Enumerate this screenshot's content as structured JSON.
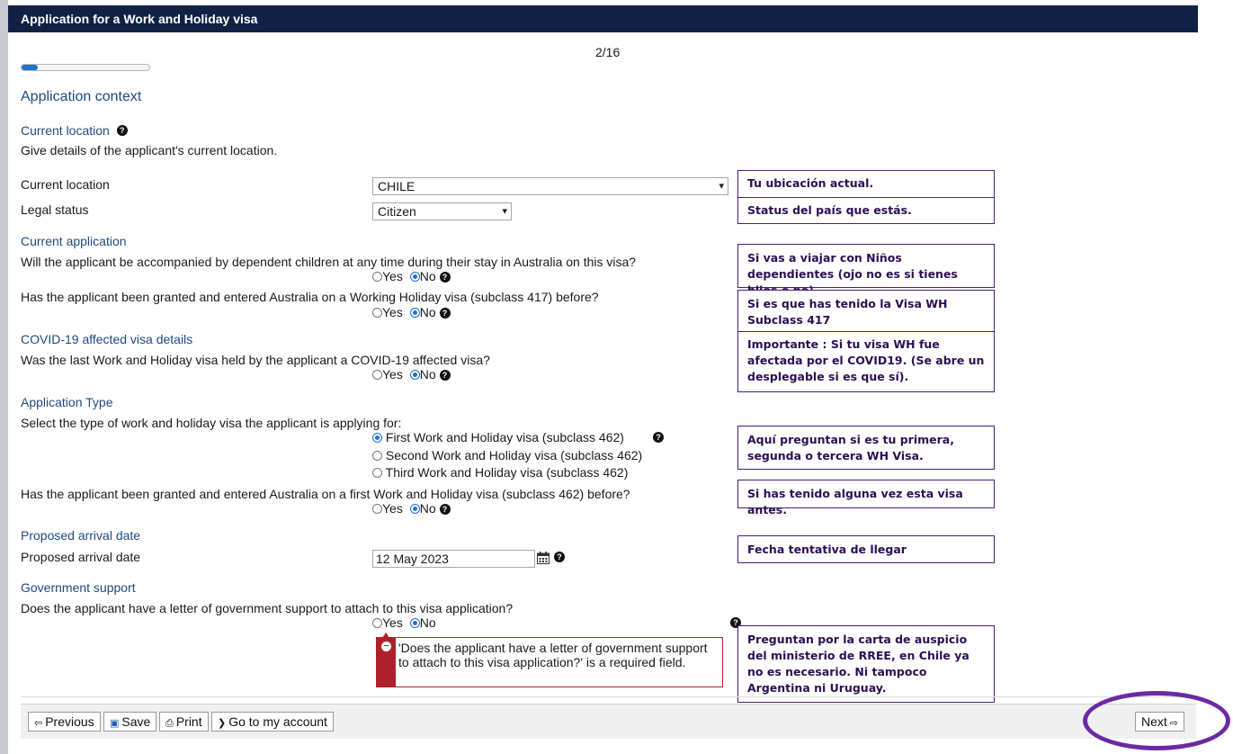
{
  "window": {
    "title": "Application for a Work and Holiday visa"
  },
  "progress": {
    "page_label": "2/16",
    "fraction": 0.125
  },
  "form": {
    "heading": "Application context",
    "current_location_section": {
      "title": "Current location",
      "description": "Give details of the applicant's current location.",
      "location_label": "Current location",
      "location_value": "CHILE",
      "legal_status_label": "Legal status",
      "legal_status_value": "Citizen"
    },
    "current_application": {
      "title": "Current application",
      "q1": "Will the applicant be accompanied by dependent children at any time during their stay in Australia on this visa?",
      "q2": "Has the applicant been granted and entered Australia on a Working Holiday visa (subclass 417) before?"
    },
    "covid": {
      "title": "COVID-19 affected visa details",
      "q": "Was the last Work and Holiday visa held by the applicant a COVID-19 affected visa?"
    },
    "application_type": {
      "title": "Application Type",
      "prompt": "Select the type of work and holiday visa the applicant is applying for:",
      "options": [
        "First Work and Holiday visa (subclass 462)",
        "Second Work and Holiday visa (subclass 462)",
        "Third Work and Holiday visa (subclass 462)"
      ],
      "q_first": "Has the applicant been granted and entered Australia on a first Work and Holiday visa (subclass 462) before?"
    },
    "arrival": {
      "title": "Proposed arrival date",
      "label": "Proposed arrival date",
      "value": "12 May 2023"
    },
    "government": {
      "title": "Government support",
      "q": "Does the applicant have a letter of government support to attach to this visa application?",
      "error": "'Does the applicant have a letter of government support to attach to this visa application?' is a required field."
    },
    "yes_label": "Yes",
    "no_label": "No"
  },
  "annotations": [
    "Tu ubicación actual.",
    "Status del país que estás.",
    "Si vas a viajar con Niños dependientes (ojo no es si tienes hijos o no).",
    "Si es que has tenido la Visa WH Subclass 417",
    "Importante : Si tu visa WH fue afectada por el COVID19. (Se abre un desplegable si es que sí).",
    "Aquí preguntan si es tu primera, segunda o tercera WH Visa.",
    "Si has tenido alguna vez esta visa antes.",
    "Fecha tentativa de llegar",
    "Preguntan por la carta de auspicio del ministerio de RREE, en Chile ya no es necesario. Ni tampoco Argentina ni Uruguay."
  ],
  "footer": {
    "previous": "Previous",
    "save": "Save",
    "print": "Print",
    "account": "Go to my account",
    "next": "Next"
  },
  "colors": {
    "title_bar": "#0f2244",
    "heading": "#1c4a80",
    "annotation_border": "#4a1e7a",
    "oval": "#6b2aa3",
    "error": "#b0202a"
  }
}
